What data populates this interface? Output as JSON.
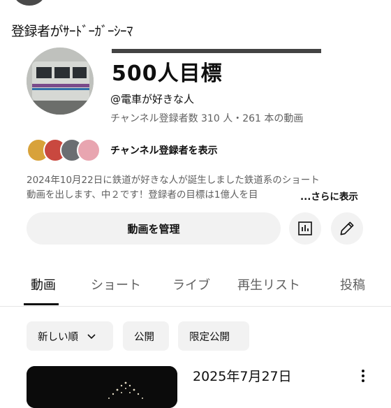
{
  "overlay_caption": "登録者がｻｰﾄﾞｰｶﾞｰｼｰﾏ",
  "channel": {
    "name": "500人目標",
    "handle": "@電車が好きな人",
    "stats": "チャンネル登録者数 310 人・261 本の動画",
    "subscribers_link": "チャンネル登録者を表示",
    "description_line1": "2024年10月22日に鉄道が好きな人が誕生しました鉄道系のショート",
    "description_line2": "動画を出します、中２です！登録者の目標は1億人を目",
    "more_label": "...さらに表示"
  },
  "actions": {
    "manage_label": "動画を管理"
  },
  "tabs": [
    {
      "label": "動画",
      "active": true
    },
    {
      "label": "ショート",
      "active": false
    },
    {
      "label": "ライブ",
      "active": false
    },
    {
      "label": "再生リスト",
      "active": false
    },
    {
      "label": "投稿",
      "active": false
    }
  ],
  "filters": {
    "sort_label": "新しい順",
    "public_label": "公開",
    "limited_label": "限定公開"
  },
  "video": {
    "date": "2025年7月27日"
  },
  "colors": {
    "chip_bg": "#f2f2f2",
    "text": "#0f0f0f",
    "secondary": "#606060"
  }
}
